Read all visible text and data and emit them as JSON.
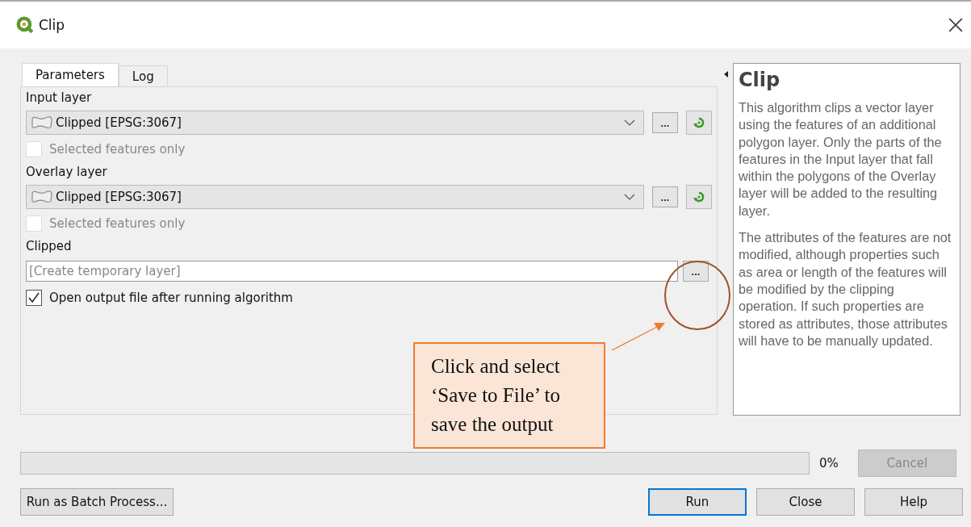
{
  "window": {
    "title": "Clip"
  },
  "tabs": [
    {
      "label": "Parameters",
      "selected": true
    },
    {
      "label": "Log",
      "selected": false
    }
  ],
  "params": [
    {
      "kind": "layer",
      "label": "Input layer",
      "value": "Clipped [EPSG:3067]",
      "browse": "...",
      "selected_only": {
        "label": "Selected features only",
        "checked": false,
        "disabled": true
      }
    },
    {
      "kind": "layer",
      "label": "Overlay layer",
      "value": "Clipped [EPSG:3067]",
      "browse": "...",
      "selected_only": {
        "label": "Selected features only",
        "checked": false,
        "disabled": true
      }
    },
    {
      "kind": "output",
      "label": "Clipped",
      "placeholder": "[Create temporary layer]",
      "browse": "...",
      "open_after": {
        "label": "Open output file after running algorithm",
        "checked": true
      }
    }
  ],
  "help": {
    "title": "Clip",
    "paragraphs": [
      "This algorithm clips a vector layer using the features of an additional polygon layer. Only the parts of the features in the Input layer that fall within the polygons of the Overlay layer will be added to the resulting layer.",
      "The attributes of the features are not modified, although properties such as area or length of the features will be modified by the clipping operation. If such properties are stored as attributes, those attributes will have to be manually updated."
    ]
  },
  "progress": {
    "level": 0,
    "reading": "0%"
  },
  "cancel": {
    "label": "Cancel",
    "disabled": true
  },
  "batch": {
    "label": "Run as Batch Process..."
  },
  "buttons": [
    {
      "label": "Run",
      "default": true
    },
    {
      "label": "Close",
      "default": false
    },
    {
      "label": "Help",
      "default": false
    }
  ],
  "callout": {
    "text": "Click and select ‘Save to File’ to save the output"
  }
}
